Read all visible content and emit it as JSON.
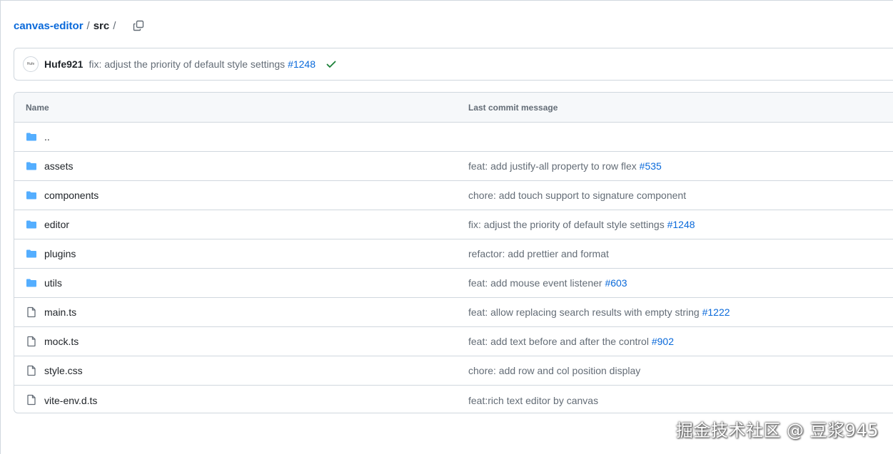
{
  "breadcrumb": {
    "repo": "canvas-editor",
    "separator": "/",
    "folder": "src",
    "trailing_separator": "/",
    "copy_icon": "copy-icon"
  },
  "latest_commit": {
    "avatar_text": "Hufe",
    "author": "Hufe921",
    "message": "fix: adjust the priority of default style settings",
    "pr": "#1248",
    "status_icon": "check-icon",
    "status_color": "#1a7f37"
  },
  "table": {
    "headers": {
      "name": "Name",
      "message": "Last commit message"
    },
    "rows": [
      {
        "type": "folder",
        "icon": "folder-icon",
        "name": "..",
        "message": "",
        "pr": ""
      },
      {
        "type": "folder",
        "icon": "folder-icon",
        "name": "assets",
        "message": "feat: add justify-all property to row flex",
        "pr": "#535"
      },
      {
        "type": "folder",
        "icon": "folder-icon",
        "name": "components",
        "message": "chore: add touch support to signature component",
        "pr": ""
      },
      {
        "type": "folder",
        "icon": "folder-icon",
        "name": "editor",
        "message": "fix: adjust the priority of default style settings",
        "pr": "#1248"
      },
      {
        "type": "folder",
        "icon": "folder-icon",
        "name": "plugins",
        "message": "refactor: add prettier and format",
        "pr": ""
      },
      {
        "type": "folder",
        "icon": "folder-icon",
        "name": "utils",
        "message": "feat: add mouse event listener",
        "pr": "#603"
      },
      {
        "type": "file",
        "icon": "file-icon",
        "name": "main.ts",
        "message": "feat: allow replacing search results with empty string",
        "pr": "#1222"
      },
      {
        "type": "file",
        "icon": "file-icon",
        "name": "mock.ts",
        "message": "feat: add text before and after the control",
        "pr": "#902"
      },
      {
        "type": "file",
        "icon": "file-icon",
        "name": "style.css",
        "message": "chore: add row and col position display",
        "pr": ""
      },
      {
        "type": "file",
        "icon": "file-icon",
        "name": "vite-env.d.ts",
        "message": "feat:rich text editor by canvas",
        "pr": ""
      }
    ]
  },
  "colors": {
    "link": "#0969da",
    "folder": "#54aeff",
    "file": "#636c76",
    "border": "#d0d7de"
  },
  "watermark": "掘金技术社区 @ 豆浆945"
}
